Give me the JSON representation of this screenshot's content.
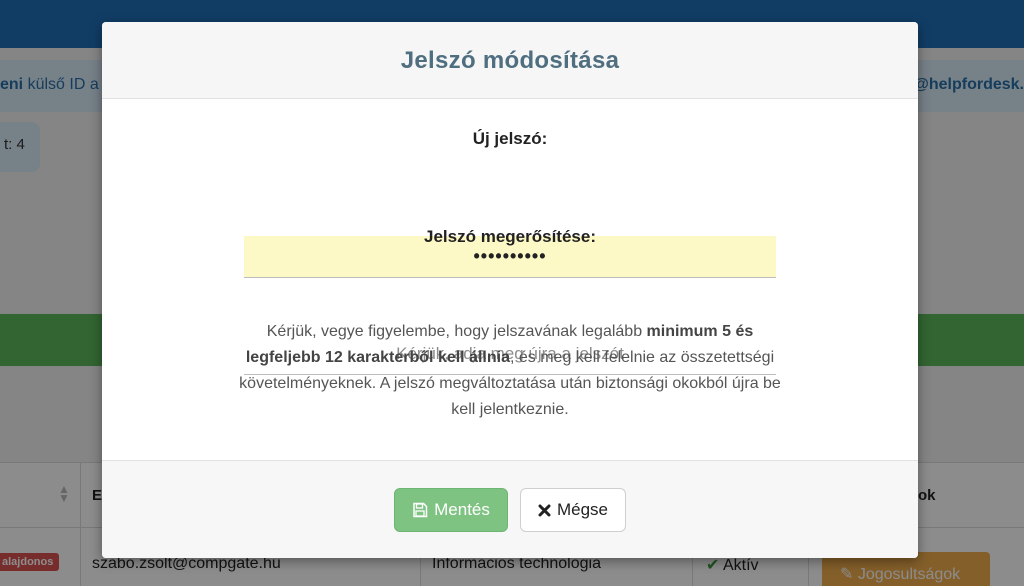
{
  "background": {
    "info_left_bold": "eni",
    "info_left_rest": " külső ID a",
    "info_right": "@helpfordesk.",
    "pill_text": "t: 4",
    "table": {
      "col_e": "E",
      "col_ok": "ok",
      "owner_badge": "alajdonos",
      "email": "szabo.zsolt@compgate.hu",
      "department": "Informacios technologia",
      "status_check": "✔",
      "status": "Aktív",
      "permissions_button": "Jogosultságok"
    }
  },
  "modal": {
    "title": "Jelszó módosítása",
    "new_password_label": "Új jelszó:",
    "new_password_value": "••••••••••",
    "confirm_label": "Jelszó megerősítése:",
    "confirm_placeholder": "Kérjük, adja meg újra a jelszót",
    "notice": {
      "part1": "Kérjük, vegye figyelembe, hogy jelszavának legalább ",
      "bold": "minimum 5 és legfeljebb 12 karakterből kell állnia",
      "part2": ", és meg kell felelnie az összetettségi követelményeknek. A jelszó megváltoztatása után biztonsági okokból újra be kell jelentkeznie."
    },
    "save_label": "Mentés",
    "cancel_label": "Mégse"
  },
  "icons": {
    "save": "floppy-disk-icon",
    "cancel": "x-mark-icon",
    "sort": "sort-icon",
    "pencil": "pencil-icon"
  },
  "colors": {
    "topbar": "#1f6fb8",
    "modal_title": "#4f6f80",
    "password_field_bg": "#fdf9c6",
    "save_button": "#7fc383",
    "success_green": "#5cb85c",
    "danger_badge": "#d9534f",
    "warning_button": "#f0ad4e"
  }
}
